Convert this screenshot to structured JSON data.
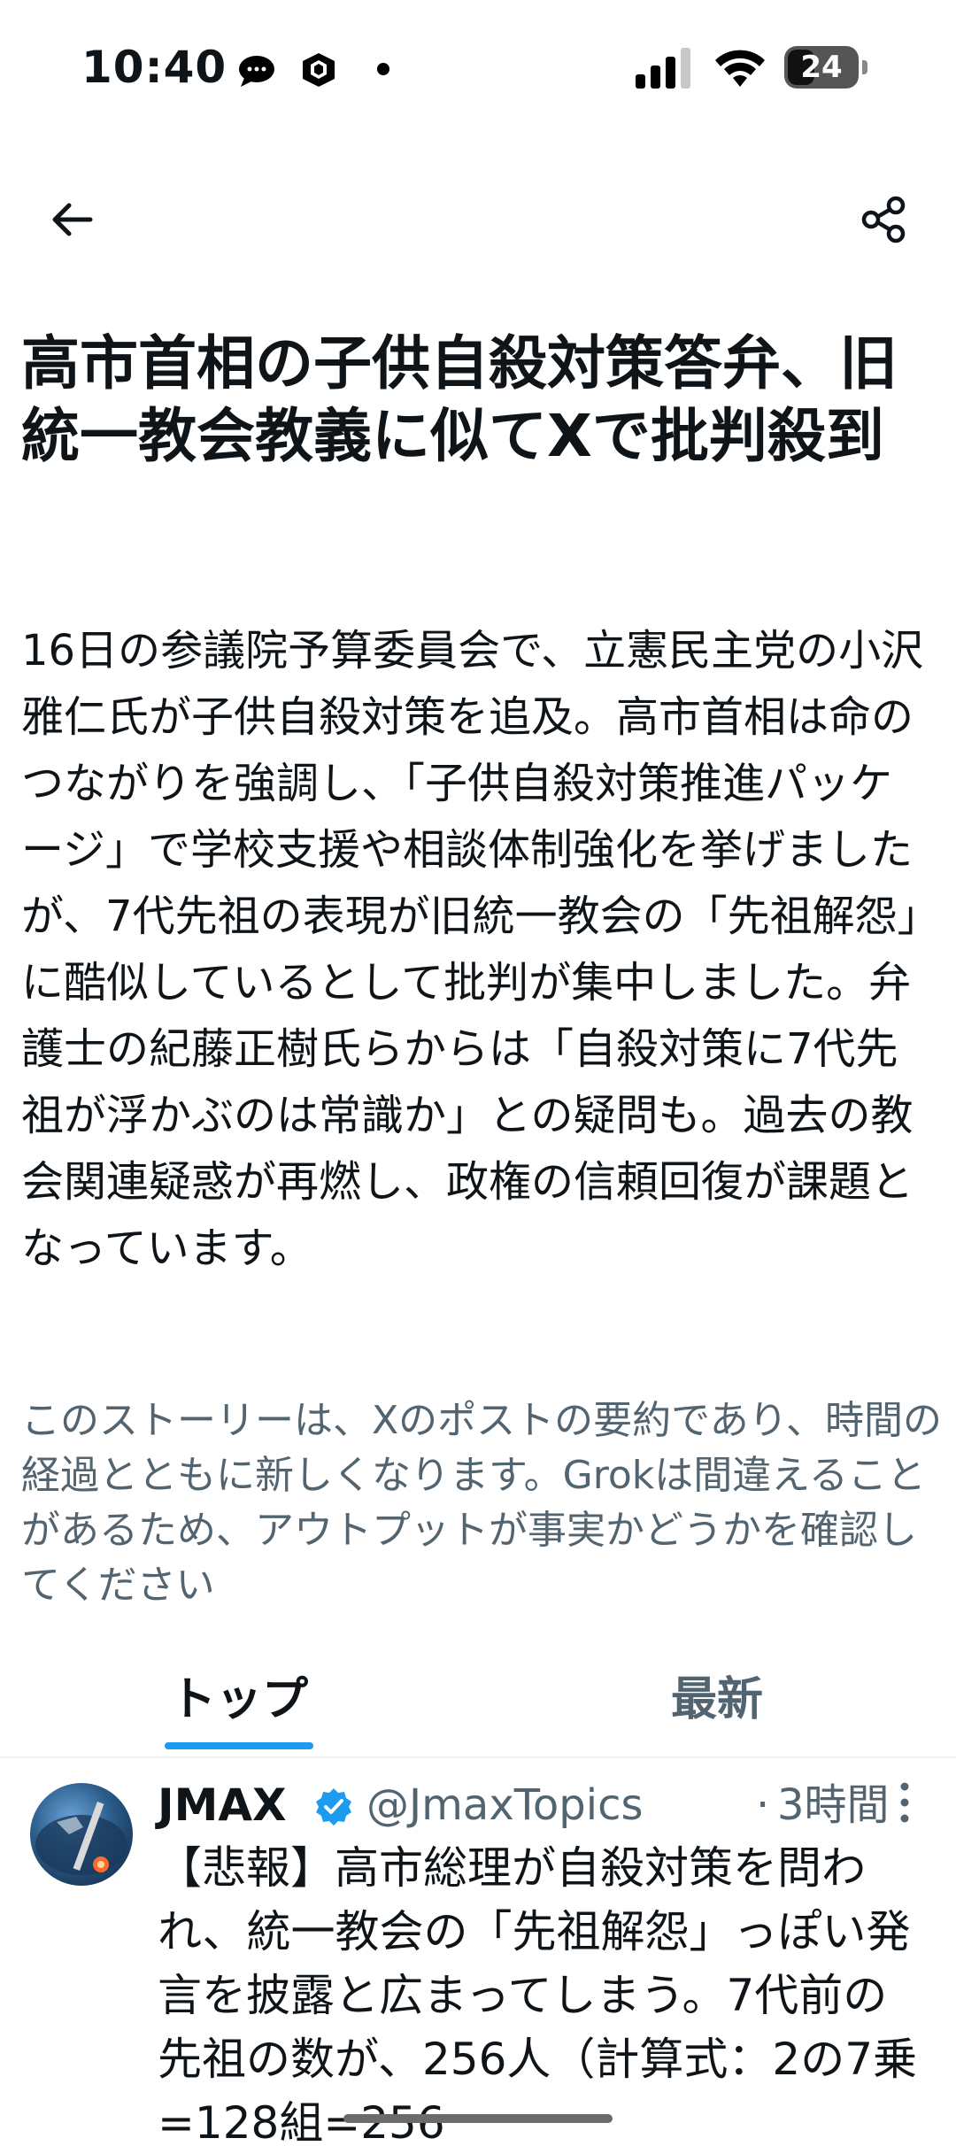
{
  "status_bar": {
    "time": "10:40",
    "battery": "24",
    "icons": [
      "chat-bubble-icon",
      "cube-icon",
      "dot-icon",
      "cellular-signal-icon",
      "wifi-icon",
      "battery-icon"
    ]
  },
  "nav": {
    "back_icon": "arrow-left-icon",
    "share_icon": "share-icon"
  },
  "story": {
    "headline": "高市首相の子供自殺対策答弁、旧統一教会教義に似てXで批判殺到",
    "summary": "16日の参議院予算委員会で、立憲民主党の小沢雅仁氏が子供自殺対策を追及。高市首相は命のつながりを強調し、「子供自殺対策推進パッケージ」で学校支援や相談体制強化を挙げましたが、7代先祖の表現が旧統一教会の「先祖解怨」に酷似しているとして批判が集中しました。弁護士の紀藤正樹氏らからは「自殺対策に7代先祖が浮かぶのは常識か」との疑問も。過去の教会関連疑惑が再燃し、政権の信頼回復が課題となっています。",
    "disclaimer": "このストーリーは、Xのポストの要約であり、時間の経過とともに新しくなります。Grokは間違えることがあるため、アウトプットが事実かどうかを確認してください"
  },
  "tabs": [
    {
      "label": "トップ",
      "active": true
    },
    {
      "label": "最新",
      "active": false
    }
  ],
  "post": {
    "name": "JMAX",
    "verified": true,
    "handle": "@JmaxTopics",
    "separator": "·",
    "time": "3時間",
    "text": "【悲報】高市総理が自殺対策を問われ、統一教会の「先祖解怨」っぽい発言を披露と広まってしまう。7代前の先祖の数が、256人（計算式：2の7乗=128組=256"
  },
  "colors": {
    "accent": "#1d9bf0",
    "text_primary": "#0f1419",
    "text_secondary": "#536471"
  }
}
